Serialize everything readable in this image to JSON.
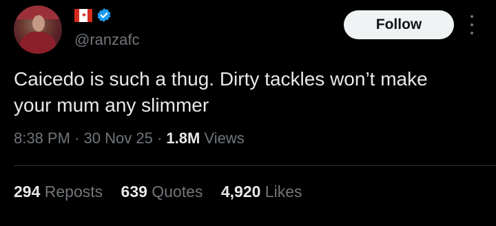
{
  "user": {
    "handle": "@ranzafc",
    "flag_emoji": "canada-flag",
    "verified": true
  },
  "actions": {
    "follow_label": "Follow"
  },
  "tweet": {
    "text": "Caicedo is such a thug. Dirty tackles won’t make your mum any slimmer",
    "time": "8:38 PM",
    "date": "30 Nov 25",
    "separator": "·",
    "views_count": "1.8M",
    "views_label": "Views"
  },
  "stats": {
    "reposts_count": "294",
    "reposts_label": "Reposts",
    "quotes_count": "639",
    "quotes_label": "Quotes",
    "likes_count": "4,920",
    "likes_label": "Likes"
  },
  "colors": {
    "background": "#000000",
    "text": "#e7e9ea",
    "muted": "#71767b",
    "verified": "#1d9bf0",
    "follow_bg": "#eff3f4"
  }
}
